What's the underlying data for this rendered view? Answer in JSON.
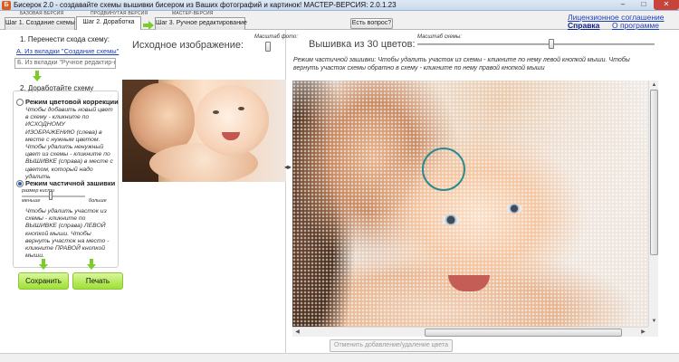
{
  "window": {
    "title": "Бисерок 2.0 - создавайте схемы вышивки бисером из Ваших фотографий и картинок! МАСТЕР-ВЕРСИЯ: 2.0.1.23",
    "min": "‒",
    "max": "□",
    "close": "✕"
  },
  "versions": {
    "base": "БАЗОВАЯ ВЕРСИЯ",
    "advanced": "ПРОДВИНУТАЯ ВЕРСИЯ",
    "master": "МАСТЕР-ВЕРСИЯ"
  },
  "tabs": [
    {
      "label": "Шаг 1. Создание схемы"
    },
    {
      "label": "Шаг 2. Доработка"
    },
    {
      "label": "Шаг 3. Ручное редактирование"
    }
  ],
  "help_button": "Есть вопрос?",
  "links": {
    "license": "Лицензионное соглашение",
    "help": "Справка",
    "about": "О программе"
  },
  "step1": {
    "title": "1. Перенести схода схему:",
    "from_tab": "А. Из вкладки \"Создание схемы\"",
    "from_editor": "Б. Из вкладки \"Ручное редактир-е\""
  },
  "step2": {
    "title": "2. Доработайте схему",
    "color_mode": "Режим цветовой коррекции",
    "color_mode_help": "Чтобы добавить новый цвет в схему - кликните по ИСХОДНОМУ ИЗОБРАЖЕНИЮ (слева) в месте с нужным цветом. Чтобы удалить ненужный цвет из схемы - кликните по ВЫШИВКЕ (справа) в месте с цветом, который надо удалить",
    "partial_mode": "Режим частичной зашивки",
    "brush_size": "размер кисти",
    "smaller": "меньше",
    "bigger": "больше",
    "partial_help": "Чтобы удалить участок из схемы - кликните по ВЫШИВКЕ (справа) ЛЕВОЙ кнопкой мыши. Чтобы вернуть участок на место - кликните ПРАВОЙ кнопкой мыши."
  },
  "buttons": {
    "save": "Сохранить",
    "print": "Печать",
    "cancel": "Отменить добавление/удаление цвета"
  },
  "source": {
    "title": "Исходное изображение:",
    "scale_label": "Масштаб фото:"
  },
  "embroidery": {
    "title": "Вышивка из 30 цветов:",
    "scale_label": "Масштаб схемы:",
    "instruction": "Режим частичной зашивки: Чтобы удалить участок из схемы - кликните по нему левой кнопкой мыши. Чтобы вернуть участок схемы обратно в схему - кликните по нему правой кнопкой мыши"
  },
  "scroll": {
    "up": "▲",
    "down": "▼",
    "left": "◀",
    "right": "▶"
  },
  "splitter": "◂▸"
}
